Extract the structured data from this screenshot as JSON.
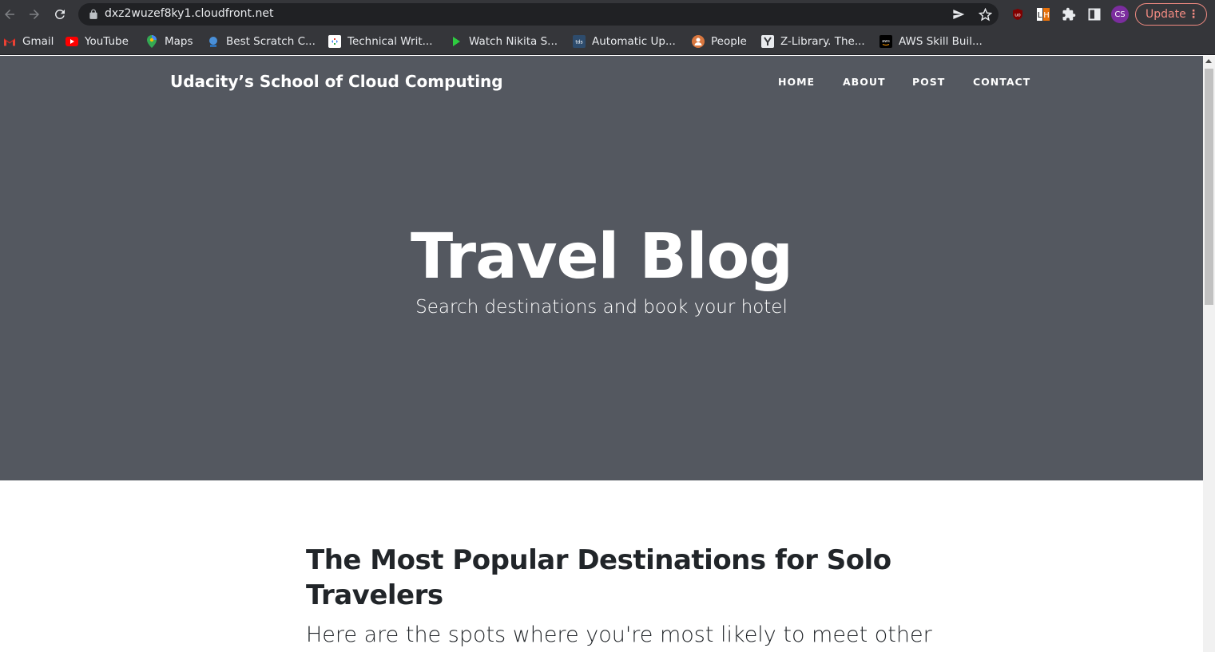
{
  "browser": {
    "url": "dxz2wuzef8ky1.cloudfront.net",
    "update_label": "Update",
    "profile_initials": "CS",
    "bookmarks": [
      {
        "label": "Gmail",
        "icon": "gmail-icon"
      },
      {
        "label": "YouTube",
        "icon": "youtube-icon"
      },
      {
        "label": "Maps",
        "icon": "maps-icon"
      },
      {
        "label": "Best Scratch C...",
        "icon": "scratch-icon"
      },
      {
        "label": "Technical Writ...",
        "icon": "technical-writing-icon"
      },
      {
        "label": "Watch Nikita S...",
        "icon": "play-icon"
      },
      {
        "label": "Automatic Up...",
        "icon": "tds-icon"
      },
      {
        "label": "People",
        "icon": "people-icon"
      },
      {
        "label": "Z-Library. The...",
        "icon": "zlibrary-icon"
      },
      {
        "label": "AWS Skill Buil...",
        "icon": "aws-icon"
      }
    ]
  },
  "site": {
    "brand": "Udacity’s School of Cloud Computing",
    "nav": [
      "HOME",
      "ABOUT",
      "POST",
      "CONTACT"
    ]
  },
  "hero": {
    "title": "Travel Blog",
    "subtitle": "Search destinations and book your hotel"
  },
  "post": {
    "title": "The Most Popular Destinations for Solo Travelers",
    "subtitle": "Here are the spots where you're most likely to meet other"
  },
  "colors": {
    "chrome": "#35363a",
    "omnibox": "#202124",
    "hero_bg": "#545860",
    "update_accent": "#f28b82",
    "text_dark": "#212529"
  }
}
